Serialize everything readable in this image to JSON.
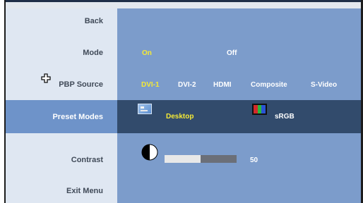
{
  "menu": {
    "back": "Back",
    "mode": "Mode",
    "pbp_source": "PBP Source",
    "preset_modes": "Preset Modes",
    "contrast": "Contrast",
    "exit": "Exit Menu"
  },
  "mode_options": {
    "on": "On",
    "off": "Off",
    "selected": "On"
  },
  "pbp_options": [
    "DVI-1",
    "DVI-2",
    "HDMI",
    "Composite",
    "S-Video"
  ],
  "pbp_selected": "DVI-1",
  "preset": {
    "desktop": "Desktop",
    "srgb": "sRGB",
    "selected": "Desktop"
  },
  "contrast": {
    "value": "50",
    "level_percent": 50
  },
  "colors": {
    "selected_text": "#f6ea35",
    "normal_text": "#ffffff",
    "label_text": "#404a58",
    "value_bg": "#7c9ccb",
    "highlight_bg": "#324b6c",
    "label_bg": "#dfe7f2"
  },
  "icons": {
    "cursor": "cursor-crosshair-icon",
    "desktop": "desktop-preset-icon",
    "srgb": "srgb-color-bars-icon",
    "contrast": "contrast-half-circle-icon"
  }
}
